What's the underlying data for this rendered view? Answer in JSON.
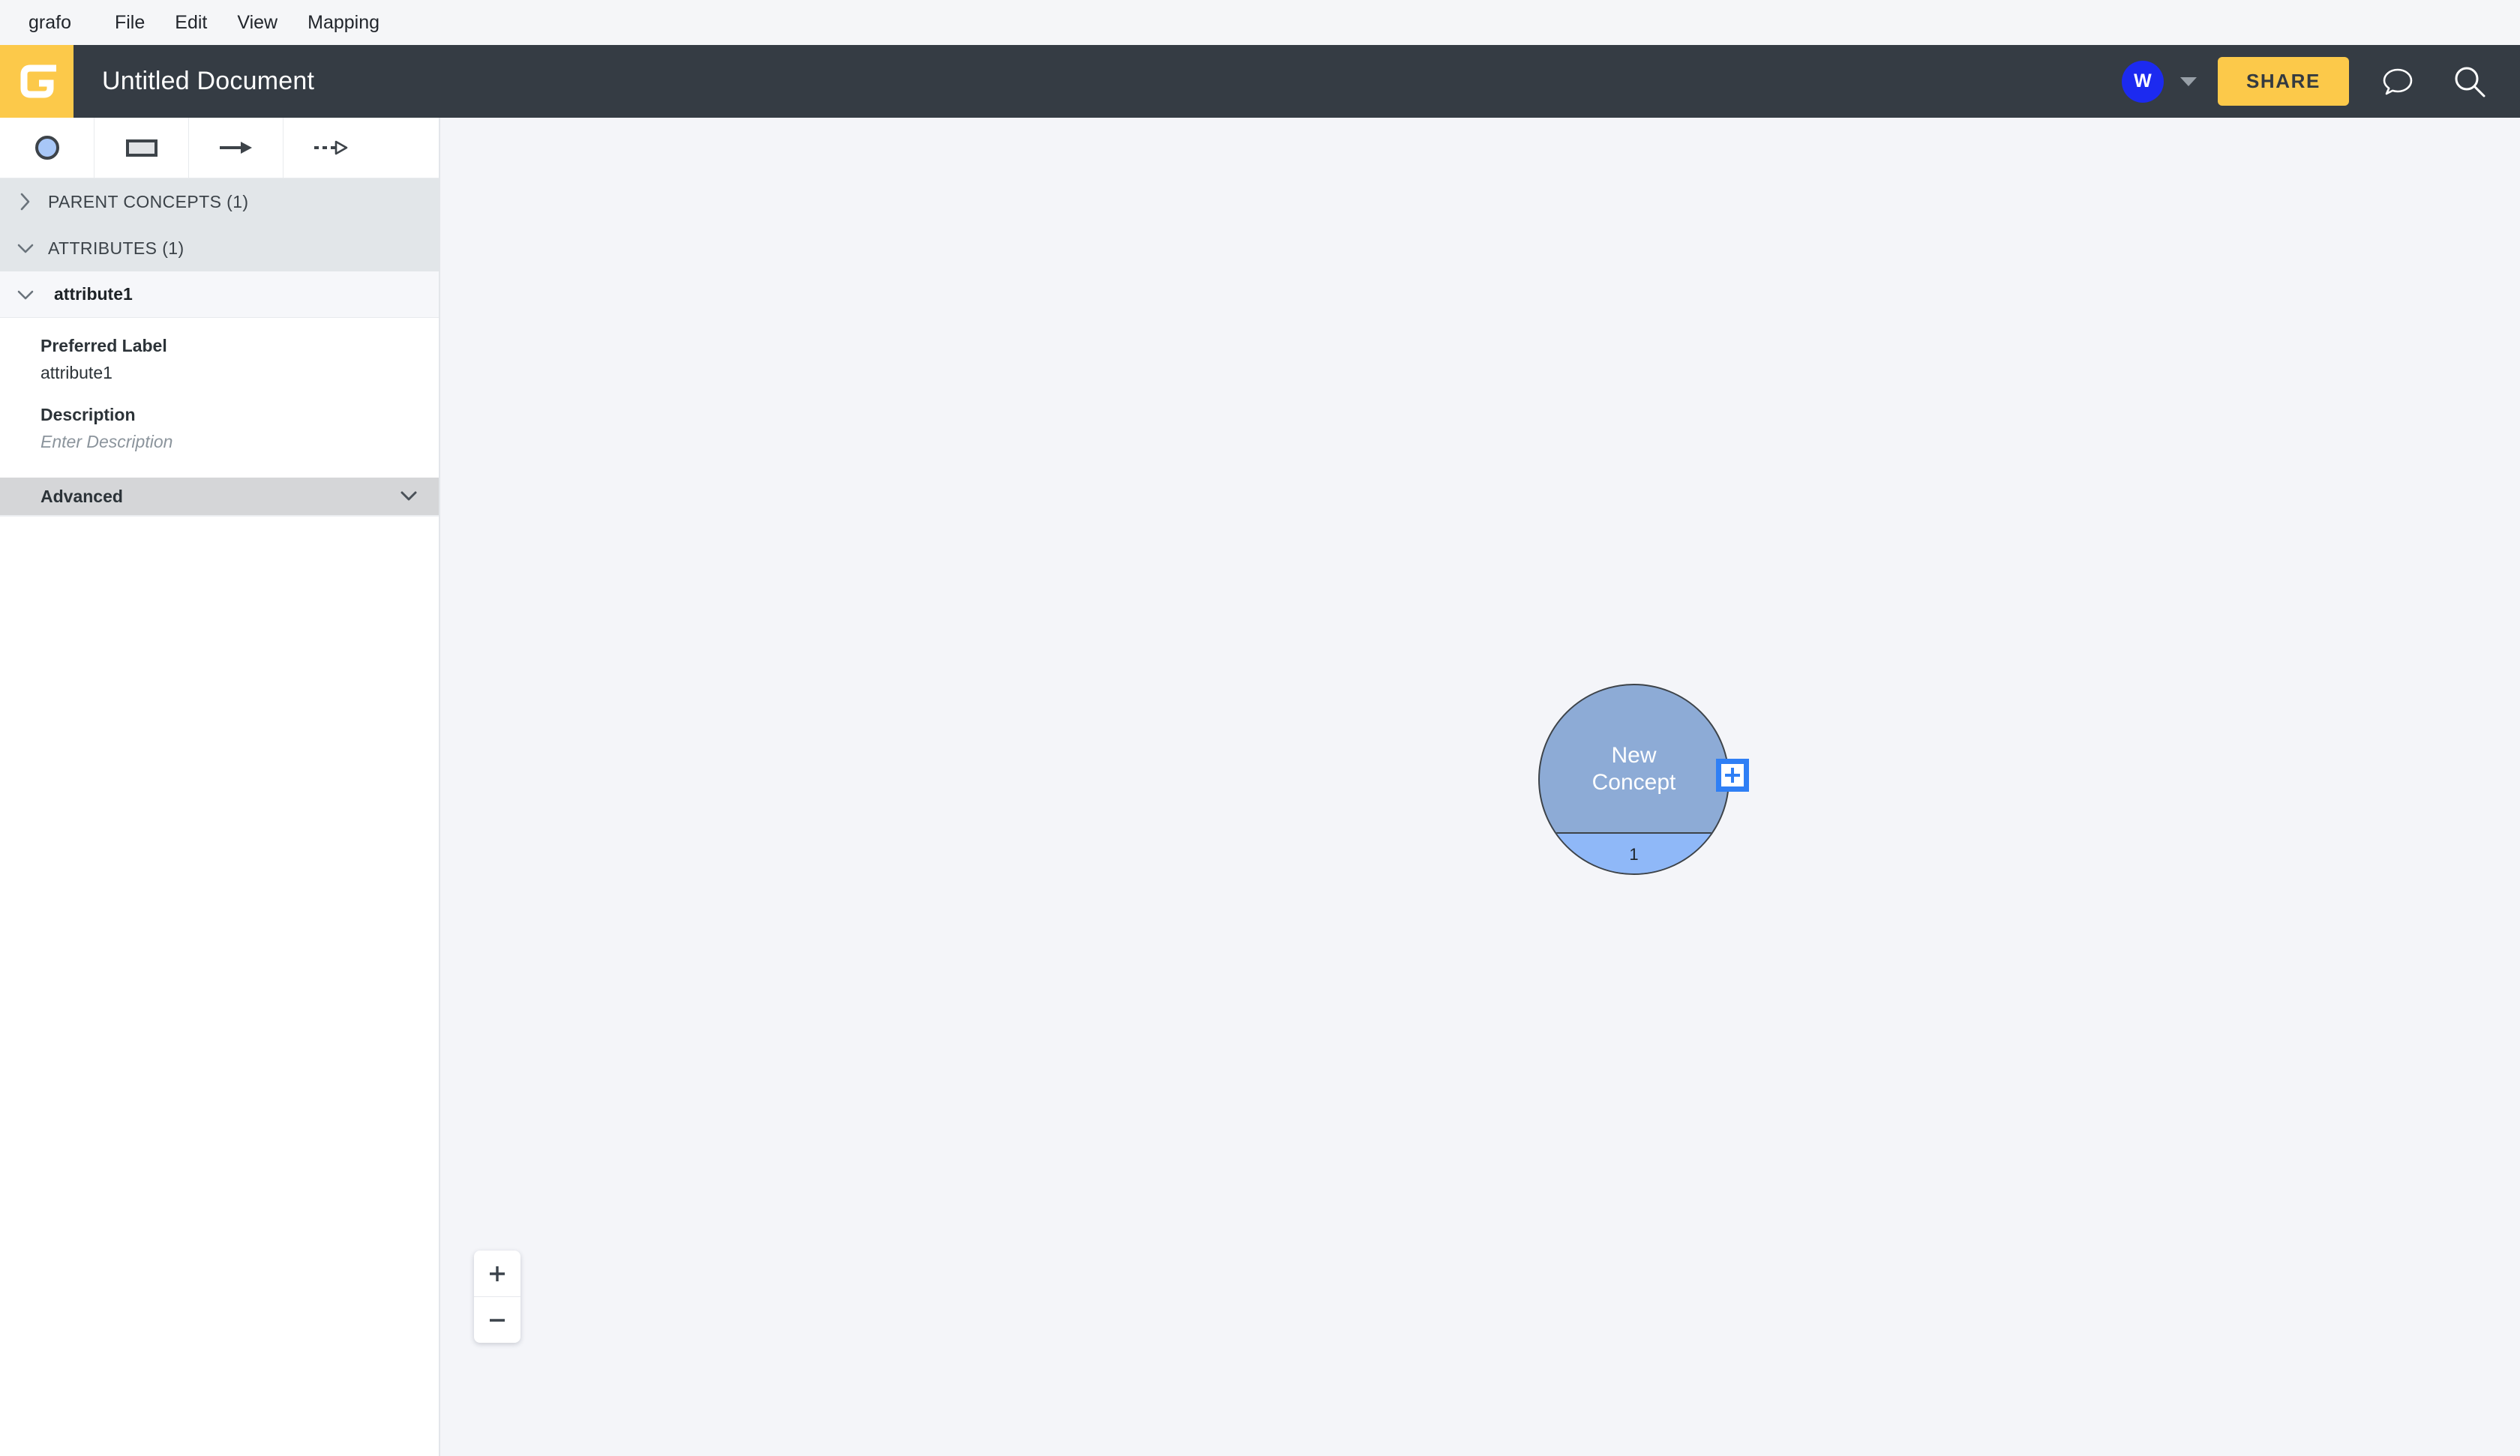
{
  "menubar": {
    "items": [
      {
        "label": "grafo",
        "name": "menu-brand"
      },
      {
        "label": "File",
        "name": "menu-file"
      },
      {
        "label": "Edit",
        "name": "menu-edit"
      },
      {
        "label": "View",
        "name": "menu-view"
      },
      {
        "label": "Mapping",
        "name": "menu-mapping"
      }
    ]
  },
  "header": {
    "logo_letter": "G",
    "document_title": "Untitled Document",
    "avatar_initial": "W",
    "share_label": "SHARE",
    "comment_icon": "speech-bubble-icon",
    "search_icon": "search-icon",
    "background_color": "#353c44",
    "accent_color": "#fcc94a",
    "avatar_color": "#1c2af0"
  },
  "toolbar": {
    "tools": [
      {
        "name": "tool-concept-circle",
        "icon": "circle-icon",
        "selected": true
      },
      {
        "name": "tool-rectangle",
        "icon": "rectangle-icon",
        "selected": false
      },
      {
        "name": "tool-relation-arrow",
        "icon": "arrow-icon",
        "selected": false
      },
      {
        "name": "tool-subclass-arrow",
        "icon": "dashed-arrow-icon",
        "selected": false
      }
    ]
  },
  "sidebar": {
    "sections": [
      {
        "label": "PARENT CONCEPTS (1)",
        "expanded": false,
        "name": "section-parent-concepts"
      },
      {
        "label": "ATTRIBUTES (1)",
        "expanded": true,
        "name": "section-attributes"
      }
    ],
    "attribute": {
      "name": "attribute1",
      "expanded": true,
      "fields": [
        {
          "label": "Preferred Label",
          "value": "attribute1",
          "placeholder": "",
          "is_placeholder": false
        },
        {
          "label": "Description",
          "value": "Enter Description",
          "placeholder": "Enter Description",
          "is_placeholder": true
        }
      ],
      "advanced_label": "Advanced",
      "advanced_expanded": false
    }
  },
  "canvas": {
    "background_color": "#f4f5f9",
    "node": {
      "label_line1": "New",
      "label_line2": "Concept",
      "badge_count": "1",
      "top_color": "#8dabd6",
      "bottom_color": "#8fb8f8",
      "add_button_icon": "plus-icon",
      "add_button_color": "#2f7ff5"
    },
    "zoom_controls": {
      "zoom_in_icon": "plus-icon",
      "zoom_out_icon": "minus-icon"
    }
  }
}
